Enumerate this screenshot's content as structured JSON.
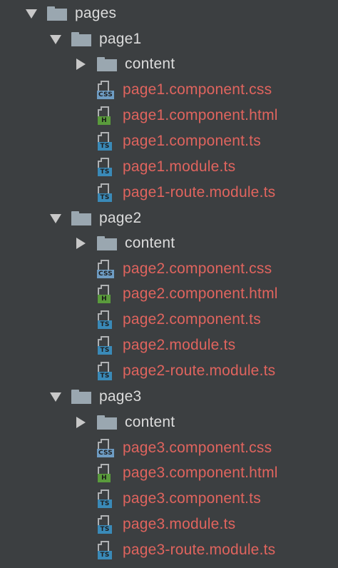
{
  "tree": {
    "root": {
      "label": "pages"
    },
    "groups": [
      {
        "folder": "page1",
        "subfolder": "content",
        "files": [
          {
            "name": "page1.component.css",
            "type": "CSS"
          },
          {
            "name": "page1.component.html",
            "type": "H"
          },
          {
            "name": "page1.component.ts",
            "type": "TS"
          },
          {
            "name": "page1.module.ts",
            "type": "TS"
          },
          {
            "name": "page1-route.module.ts",
            "type": "TS"
          }
        ]
      },
      {
        "folder": "page2",
        "subfolder": "content",
        "files": [
          {
            "name": "page2.component.css",
            "type": "CSS"
          },
          {
            "name": "page2.component.html",
            "type": "H"
          },
          {
            "name": "page2.component.ts",
            "type": "TS"
          },
          {
            "name": "page2.module.ts",
            "type": "TS"
          },
          {
            "name": "page2-route.module.ts",
            "type": "TS"
          }
        ]
      },
      {
        "folder": "page3",
        "subfolder": "content",
        "files": [
          {
            "name": "page3.component.css",
            "type": "CSS"
          },
          {
            "name": "page3.component.html",
            "type": "H"
          },
          {
            "name": "page3.component.ts",
            "type": "TS"
          },
          {
            "name": "page3.module.ts",
            "type": "TS"
          },
          {
            "name": "page3-route.module.ts",
            "type": "TS"
          }
        ]
      }
    ]
  },
  "icons": {
    "expanded": "chevron-down-icon",
    "collapsed": "chevron-right-icon",
    "folder": "folder-icon",
    "css": "css-file-icon",
    "html": "html-file-icon",
    "ts": "ts-file-icon"
  },
  "colors": {
    "background": "#3c3f41",
    "folder_text": "#dcdcdc",
    "file_text_modified": "#e0645e",
    "folder_icon": "#9aa7b0",
    "badge_css": "#6e9cc3",
    "badge_html": "#5a9b3c",
    "badge_ts": "#3a8ab8"
  }
}
